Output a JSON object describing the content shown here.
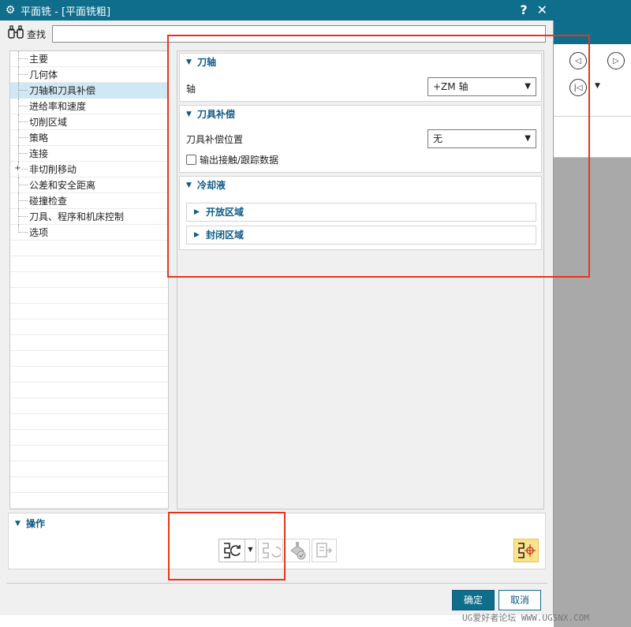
{
  "dialog": {
    "title": "平面铣 - [平面铣粗]",
    "help_label": "?",
    "close_label": "✕"
  },
  "search": {
    "label": "查找",
    "value": ""
  },
  "tree": {
    "items": [
      {
        "label": "主要",
        "selected": false,
        "expandable": false
      },
      {
        "label": "几何体",
        "selected": false,
        "expandable": false
      },
      {
        "label": "刀轴和刀具补偿",
        "selected": true,
        "expandable": false
      },
      {
        "label": "进给率和速度",
        "selected": false,
        "expandable": false
      },
      {
        "label": "切削区域",
        "selected": false,
        "expandable": false
      },
      {
        "label": "策略",
        "selected": false,
        "expandable": false
      },
      {
        "label": "连接",
        "selected": false,
        "expandable": false
      },
      {
        "label": "非切削移动",
        "selected": false,
        "expandable": true
      },
      {
        "label": "公差和安全距离",
        "selected": false,
        "expandable": false
      },
      {
        "label": "碰撞检查",
        "selected": false,
        "expandable": false
      },
      {
        "label": "刀具、程序和机床控制",
        "selected": false,
        "expandable": false
      },
      {
        "label": "选项",
        "selected": false,
        "expandable": false
      }
    ]
  },
  "tool_axis": {
    "header": "刀轴",
    "axis_label": "轴",
    "axis_value": "+ZM 轴"
  },
  "tool_comp": {
    "header": "刀具补偿",
    "position_label": "刀具补偿位置",
    "position_value": "无",
    "output_checkbox_label": "输出接触/跟踪数据",
    "output_checked": false
  },
  "coolant": {
    "header": "冷却液",
    "open_region": "开放区域",
    "closed_region": "封闭区域"
  },
  "operations": {
    "header": "操作"
  },
  "buttons": {
    "ok": "确定",
    "cancel": "取消"
  },
  "watermark": "UG爱好者论坛 WWW.UGSNX.COM",
  "colors": {
    "title_bar": "#0e6e8c",
    "selection": "#cfe8f3",
    "section_header": "#0e5a86",
    "annotation_red": "#e8341c",
    "highlight_button": "#fbe38a"
  },
  "icons": {
    "title": "gear-icon",
    "search": "binoculars-icon",
    "generate": "generate-path-icon",
    "replay": "replay-icon",
    "verify": "verify-icon",
    "list": "list-icon",
    "display": "display-path-icon"
  }
}
